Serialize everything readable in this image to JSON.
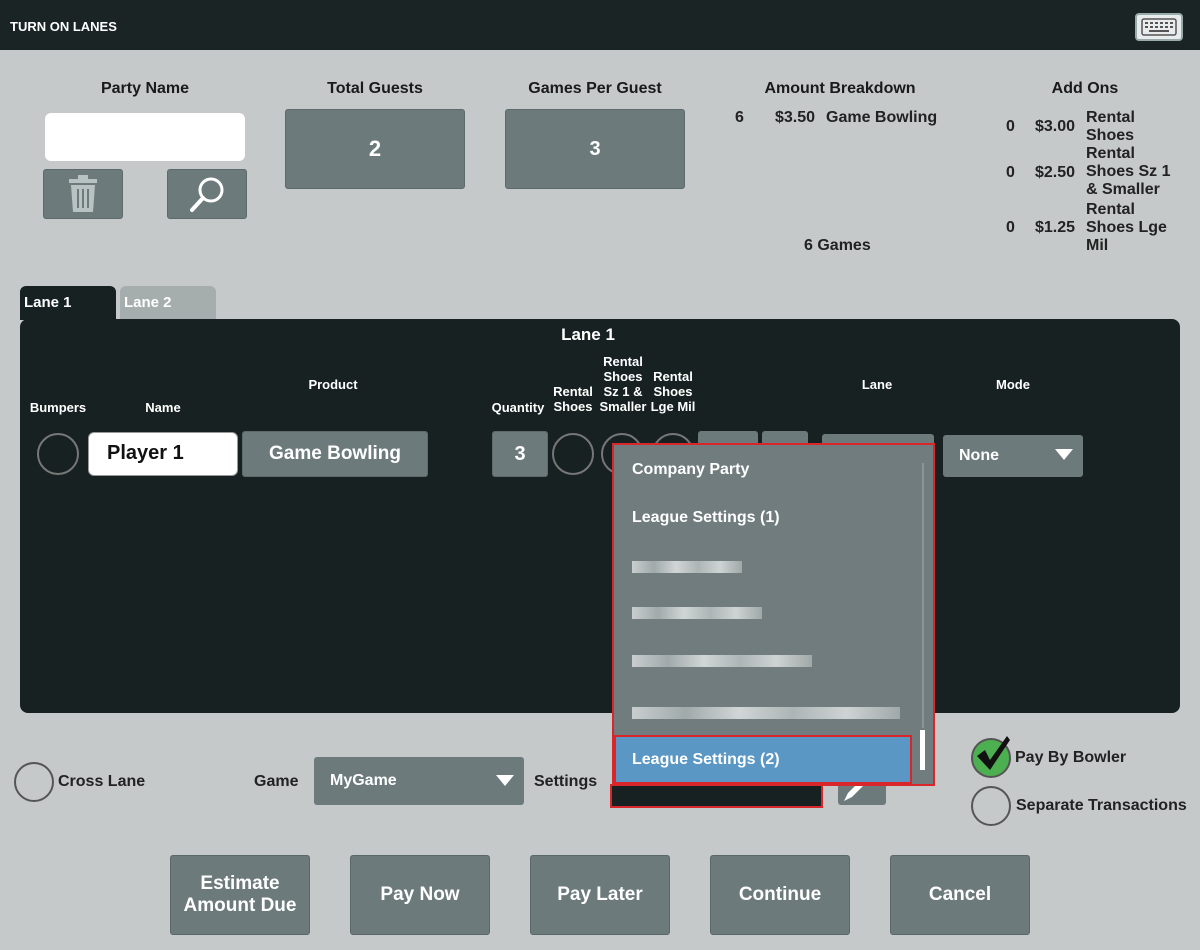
{
  "window": {
    "title": "TURN ON LANES"
  },
  "party": {
    "party_name_label": "Party Name",
    "party_name_value": "",
    "total_guests_label": "Total Guests",
    "total_guests_value": "2",
    "games_per_guest_label": "Games Per Guest",
    "games_per_guest_value": "3"
  },
  "amount_breakdown": {
    "label": "Amount Breakdown",
    "qty": "6",
    "price": "$3.50",
    "item": "Game Bowling",
    "total": "6 Games"
  },
  "add_ons": {
    "label": "Add Ons",
    "items": [
      {
        "qty": "0",
        "price": "$3.00",
        "name": "Rental Shoes"
      },
      {
        "qty": "0",
        "price": "$2.50",
        "name": "Rental Shoes Sz 1 & Smaller"
      },
      {
        "qty": "0",
        "price": "$1.25",
        "name": "Rental Shoes Lge Mil"
      }
    ]
  },
  "tabs": [
    {
      "label": "Lane 1"
    },
    {
      "label": "Lane 2"
    }
  ],
  "lane": {
    "title": "Lane 1",
    "headers": {
      "bumpers": "Bumpers",
      "name": "Name",
      "product": "Product",
      "quantity": "Quantity",
      "rental_shoes": "Rental Shoes",
      "rental_shoes_small": "Rental Shoes Sz 1 & Smaller",
      "rental_shoes_lge": "Rental Shoes Lge Mil",
      "lane": "Lane",
      "mode": "Mode"
    },
    "player": {
      "name": "Player 1",
      "product": "Game Bowling",
      "quantity": "3",
      "mode": "None"
    }
  },
  "settings_dropdown": {
    "options": [
      "Company Party",
      "League Settings (1)"
    ],
    "selected": "League Settings (2)"
  },
  "bottom": {
    "cross_lane_label": "Cross Lane",
    "game_label": "Game",
    "game_value": "MyGame",
    "settings_label": "Settings",
    "pay_by_bowler_label": "Pay By Bowler",
    "separate_transactions_label": "Separate Transactions"
  },
  "actions": {
    "estimate": "Estimate Amount Due",
    "pay_now": "Pay Now",
    "pay_later": "Pay Later",
    "continue": "Continue",
    "cancel": "Cancel"
  },
  "colors": {
    "accent_selected": "#5a97c4",
    "highlight_border": "#d9262a",
    "check_green": "#4caf50"
  },
  "icons": [
    "keyboard-icon",
    "trash-icon",
    "search-icon",
    "chevron-down-icon",
    "checkmark-icon",
    "pencil-icon"
  ]
}
